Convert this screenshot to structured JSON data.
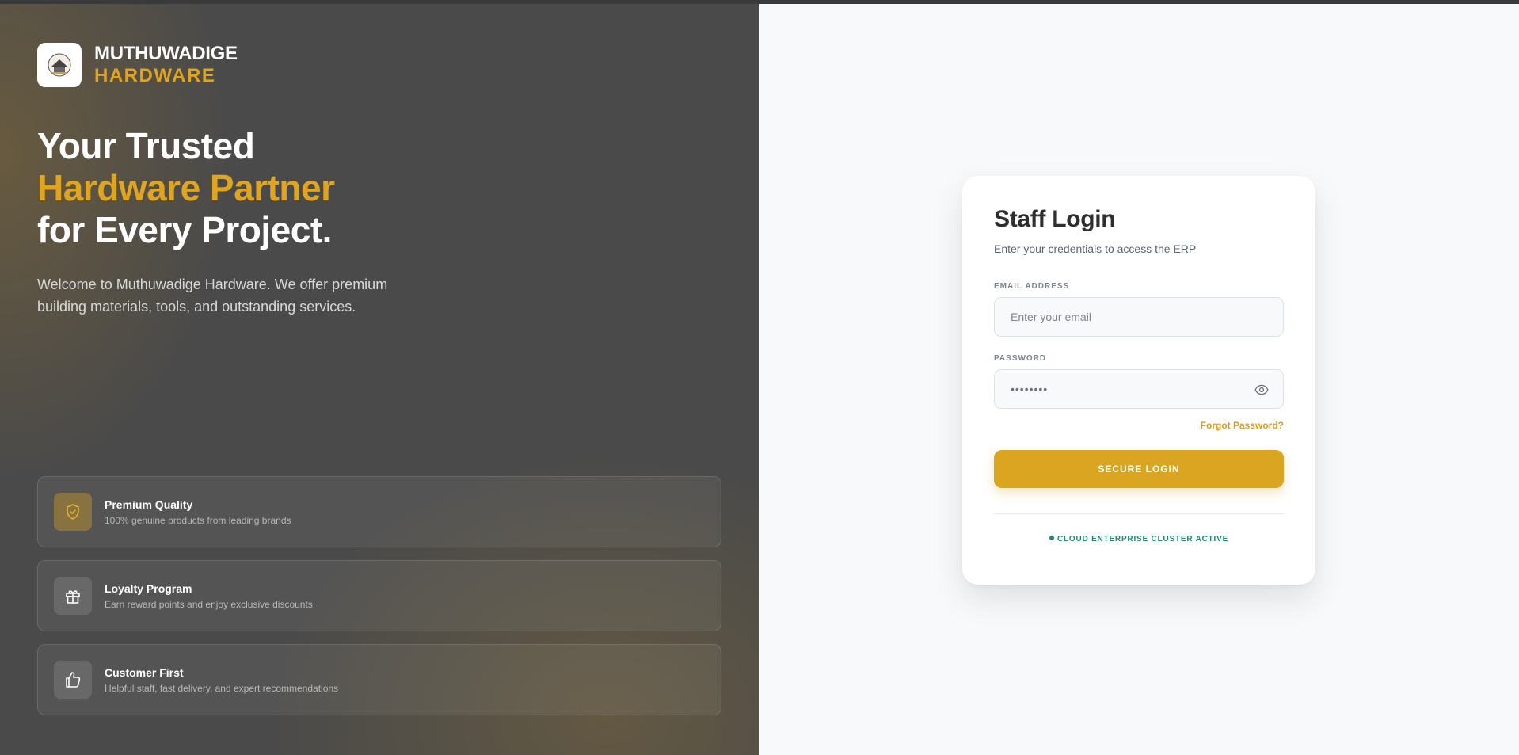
{
  "brand": {
    "name_top": "MUTHUWADIGE",
    "name_bottom": "HARDWARE",
    "logo_icon": "store-logo-icon"
  },
  "hero": {
    "line1": "Your Trusted",
    "line2": "Hardware Partner",
    "line3": "for Every Project.",
    "intro": "Welcome to Muthuwadige Hardware. We offer premium building materials, tools, and outstanding services."
  },
  "features": [
    {
      "icon": "shield-check-icon",
      "title": "Premium Quality",
      "desc": "100% genuine products from leading brands"
    },
    {
      "icon": "gift-icon",
      "title": "Loyalty Program",
      "desc": "Earn reward points and enjoy exclusive discounts"
    },
    {
      "icon": "thumbs-up-icon",
      "title": "Customer First",
      "desc": "Helpful staff, fast delivery, and expert recommendations"
    }
  ],
  "login": {
    "title": "Staff Login",
    "subtitle": "Enter your credentials to access the ERP",
    "email_label": "EMAIL ADDRESS",
    "email_placeholder": "Enter your email",
    "password_label": "PASSWORD",
    "password_value": "••••••••",
    "forgot": "Forgot Password?",
    "submit": "SECURE LOGIN",
    "status": "CLOUD ENTERPRISE CLUSTER ACTIVE"
  },
  "colors": {
    "accent": "#daa520",
    "dark_panel": "#4a4a4a",
    "status_green": "#1e8a6e"
  }
}
